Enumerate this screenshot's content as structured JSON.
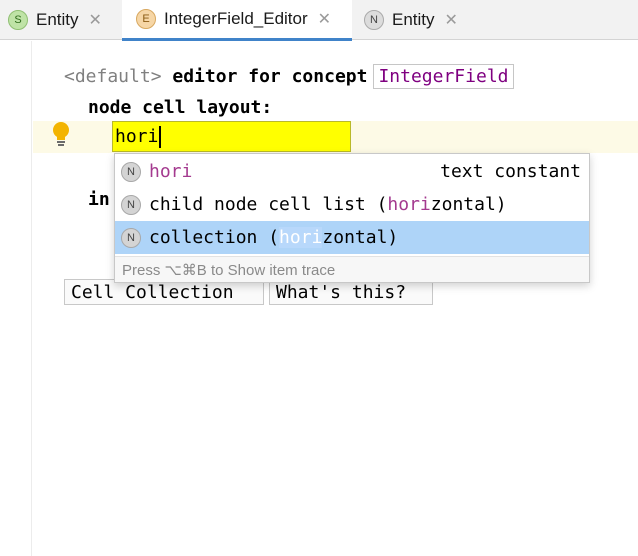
{
  "tabs": [
    {
      "badge": "S",
      "label": "Entity",
      "active": false
    },
    {
      "badge": "E",
      "label": "IntegerField_Editor",
      "active": true
    },
    {
      "badge": "N",
      "label": "Entity",
      "active": false
    }
  ],
  "tab_close_glyph": "✕",
  "editor": {
    "line1_default": "<default>",
    "line1_text": " editor for concept",
    "concept_name": "IntegerField",
    "line2_text": "node cell layout:",
    "input_value": "hori",
    "partial_line_text": "in"
  },
  "completion": {
    "items": [
      {
        "badge": "N",
        "prefix": "",
        "match": "hori",
        "suffix": "",
        "type": "text constant"
      },
      {
        "badge": "N",
        "prefix": "child node cell list (",
        "match": "hori",
        "suffix": "zontal)",
        "type": ""
      },
      {
        "badge": "N",
        "prefix": "collection (",
        "match": "hori",
        "suffix": "zontal)",
        "type": ""
      }
    ],
    "selected_index": 2,
    "footer": "Press ⌥⌘B to Show item trace"
  },
  "buttons": {
    "cell_collection": "Cell Collection",
    "whats_this": "What's this?"
  },
  "colors": {
    "tab_accent": "#4083c9",
    "match": "#a43a8f",
    "selected_row": "#aed4f8",
    "input_bg": "#ffff00",
    "concept": "#7f0080"
  }
}
